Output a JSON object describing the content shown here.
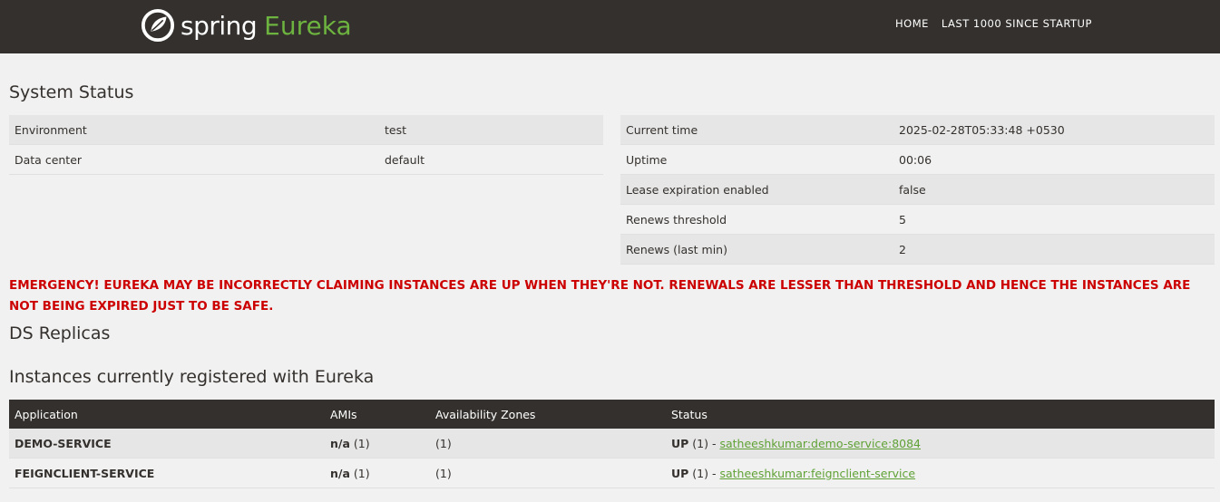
{
  "brand": {
    "spring": "spring",
    "eureka": "Eureka"
  },
  "nav": {
    "home": "HOME",
    "last1000": "LAST 1000 SINCE STARTUP"
  },
  "system_status": {
    "title": "System Status",
    "left": [
      {
        "label": "Environment",
        "value": "test"
      },
      {
        "label": "Data center",
        "value": "default"
      }
    ],
    "right": [
      {
        "label": "Current time",
        "value": "2025-02-28T05:33:48 +0530"
      },
      {
        "label": "Uptime",
        "value": "00:06"
      },
      {
        "label": "Lease expiration enabled",
        "value": "false"
      },
      {
        "label": "Renews threshold",
        "value": "5"
      },
      {
        "label": "Renews (last min)",
        "value": "2"
      }
    ]
  },
  "emergency": "EMERGENCY! EUREKA MAY BE INCORRECTLY CLAIMING INSTANCES ARE UP WHEN THEY'RE NOT. RENEWALS ARE LESSER THAN THRESHOLD AND HENCE THE INSTANCES ARE NOT BEING EXPIRED JUST TO BE SAFE.",
  "ds_replicas": {
    "title": "DS Replicas"
  },
  "instances": {
    "title": "Instances currently registered with Eureka",
    "headers": [
      "Application",
      "AMIs",
      "Availability Zones",
      "Status"
    ],
    "rows": [
      {
        "app": "DEMO-SERVICE",
        "ami_label": "n/a",
        "ami_count": "(1)",
        "zones": "(1)",
        "status": "UP",
        "status_count": "(1) - ",
        "link": "satheeshkumar:demo-service:8084"
      },
      {
        "app": "FEIGNCLIENT-SERVICE",
        "ami_label": "n/a",
        "ami_count": "(1)",
        "zones": "(1)",
        "status": "UP",
        "status_count": "(1) - ",
        "link": "satheeshkumar:feignclient-service"
      }
    ]
  },
  "colors": {
    "nav_bg": "#34302d",
    "brand_green": "#6db33f",
    "emergency_red": "#cc0000",
    "link_green": "#5fa134",
    "page_bg": "#f1f1f1"
  },
  "icons": {
    "logo": "spring-logo-icon"
  }
}
